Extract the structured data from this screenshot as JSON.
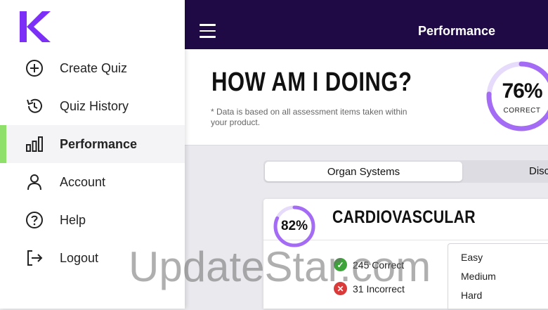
{
  "app": {
    "logo_letter": "K",
    "brand_color": "#7b2ff7"
  },
  "sidebar": {
    "items": [
      {
        "label": "Create Quiz",
        "icon": "plus-circle-icon"
      },
      {
        "label": "Quiz History",
        "icon": "history-icon"
      },
      {
        "label": "Performance",
        "icon": "bar-chart-icon",
        "active": true
      },
      {
        "label": "Account",
        "icon": "user-icon"
      },
      {
        "label": "Help",
        "icon": "help-circle-icon"
      },
      {
        "label": "Logout",
        "icon": "logout-icon"
      }
    ],
    "active_color": "#8ee06b"
  },
  "topbar": {
    "title": "Performance",
    "background": "#1f0a45"
  },
  "summary": {
    "heading": "HOW AM I DOING?",
    "note": "* Data is based on all assessment items taken within your product.",
    "overall_percent": "76%",
    "overall_fraction": 0.76,
    "overall_label": "CORRECT",
    "ring_color": "#a46cf5"
  },
  "tabs": {
    "active": "Organ Systems",
    "next": "Disc"
  },
  "topic": {
    "title": "CARDIOVASCULAR",
    "percent": "82%",
    "fraction": 0.82,
    "correct": "245 Correct",
    "incorrect": "31 Incorrect",
    "difficulty": [
      "Easy",
      "Medium",
      "Hard"
    ]
  },
  "watermark": "UpdateStar.com"
}
